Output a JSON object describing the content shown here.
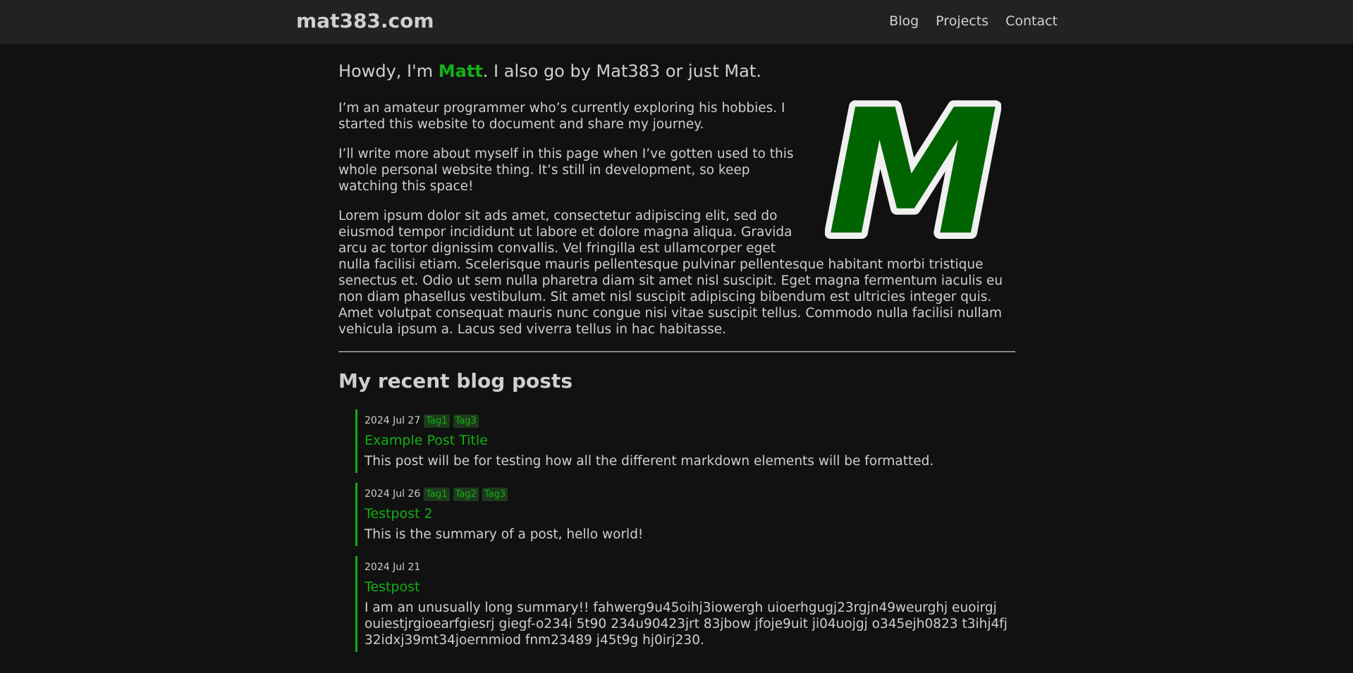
{
  "header": {
    "site_title": "mat383.com",
    "nav": [
      {
        "label": "Blog"
      },
      {
        "label": "Projects"
      },
      {
        "label": "Contact"
      }
    ]
  },
  "intro": {
    "prefix": "Howdy, I'm ",
    "name": "Matt",
    "suffix": ". I also go by Mat383 or just Mat."
  },
  "logo": {
    "letter": "M",
    "fill_color": "#006400",
    "outline_color": "#f0f0f0"
  },
  "about": {
    "paragraphs": [
      "I’m an amateur programmer who’s currently exploring his hobbies. I started this website to document and share my journey.",
      "I’ll write more about myself in this page when I’ve gotten used to this whole personal website thing. It’s still in development, so keep watching this space!",
      "Lorem ipsum dolor sit ads amet, consectetur adipiscing elit, sed do eiusmod tempor incididunt ut labore et dolore magna aliqua. Gravida arcu ac tortor dignissim convallis. Vel fringilla est ullamcorper eget nulla facilisi etiam. Scelerisque mauris pellentesque pulvinar pellentesque habitant morbi tristique senectus et. Odio ut sem nulla pharetra diam sit amet nisl suscipit. Eget magna fermentum iaculis eu non diam phasellus vestibulum. Sit amet nisl suscipit adipiscing bibendum est ultricies integer quis. Amet volutpat consequat mauris nunc congue nisi vitae suscipit tellus. Commodo nulla facilisi nullam vehicula ipsum a. Lacus sed viverra tellus in hac habitasse."
    ]
  },
  "recent_posts": {
    "title": "My recent blog posts",
    "posts": [
      {
        "date": "2024 Jul 27",
        "tags": [
          "Tag1",
          "Tag3"
        ],
        "title": "Example Post Title",
        "summary": "This post will be for testing how all the different markdown elements will be formatted."
      },
      {
        "date": "2024 Jul 26",
        "tags": [
          "Tag1",
          "Tag2",
          "Tag3"
        ],
        "title": "Testpost 2",
        "summary": "This is the summary of a post, hello world!"
      },
      {
        "date": "2024 Jul 21",
        "tags": [],
        "title": "Testpost",
        "summary": "I am an unusually long summary!! fahwerg9u45oihj3iowergh uioerhgugj23rgjn49weurghj euoirgj ouiestjrgioearfgiesrj giegf-o234i 5t90 234u90423jrt 83jbow jfoje9uit ji04uojgj o345ejh0823 t3ihj4fj 32idxj39mt34joernmiod fnm23489 j45t9g hj0irj230."
      }
    ]
  },
  "colors": {
    "accent": "#12b012",
    "background": "#111111",
    "header_background": "#222222",
    "text": "#cfcfcf"
  }
}
